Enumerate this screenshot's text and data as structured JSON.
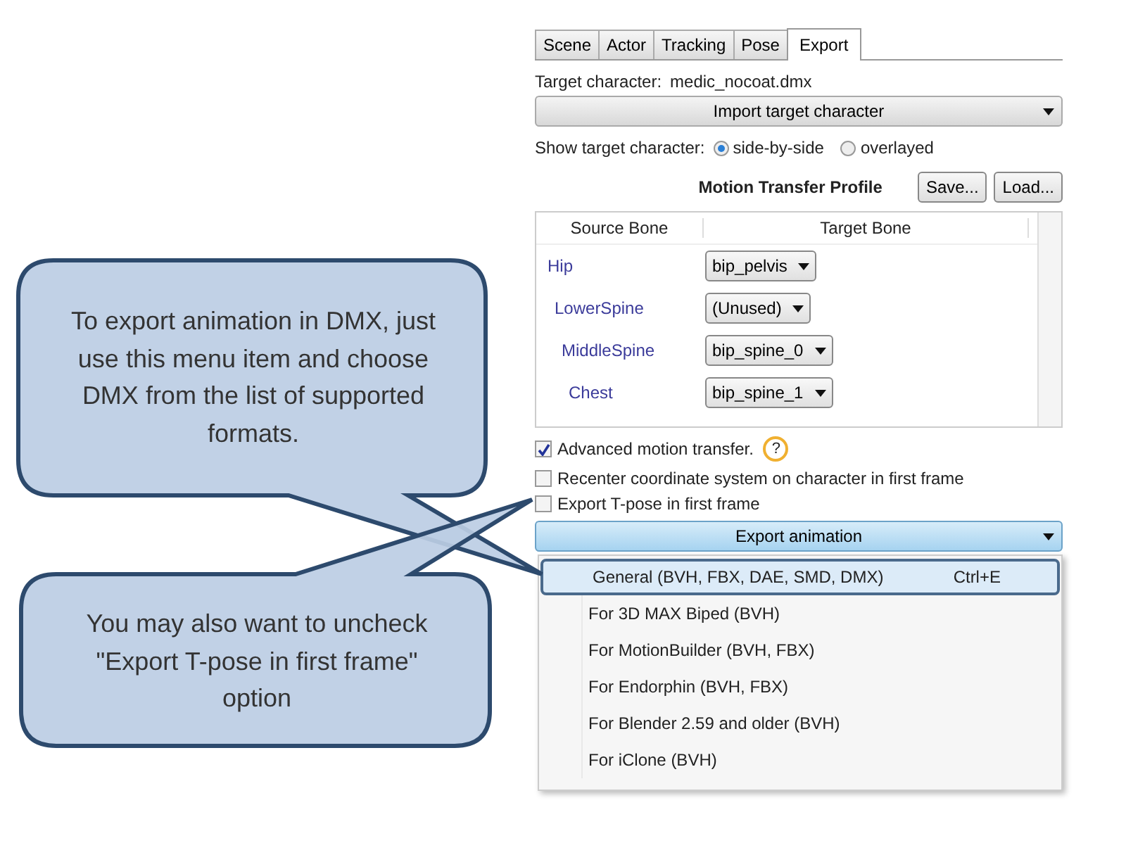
{
  "tabs": [
    {
      "label": "Scene",
      "selected": false
    },
    {
      "label": "Actor",
      "selected": false
    },
    {
      "label": "Tracking",
      "selected": false
    },
    {
      "label": "Pose",
      "selected": false
    },
    {
      "label": "Export",
      "selected": true
    }
  ],
  "target_character": {
    "label": "Target character:",
    "value": "medic_nocoat.dmx"
  },
  "import_button": "Import target character",
  "show_target": {
    "label": "Show target character:",
    "options": [
      {
        "label": "side-by-side",
        "selected": true
      },
      {
        "label": "overlayed",
        "selected": false
      }
    ]
  },
  "profile": {
    "title": "Motion Transfer Profile",
    "buttons": [
      "Save...",
      "Load..."
    ]
  },
  "bone_table": {
    "columns": [
      "Source Bone",
      "Target Bone"
    ],
    "rows": [
      {
        "source": "Hip",
        "target": "bip_pelvis",
        "children": [
          {
            "source": "LowerSpine",
            "target": "(Unused)",
            "children": [
              {
                "source": "MiddleSpine",
                "target": "bip_spine_0",
                "children": [
                  {
                    "source": "Chest",
                    "target": "bip_spine_1"
                  }
                ]
              }
            ]
          }
        ]
      }
    ]
  },
  "options": [
    {
      "label": "Advanced motion transfer.",
      "checked": true,
      "help": "?"
    },
    {
      "label": "Recenter coordinate system on character in first frame",
      "checked": false
    },
    {
      "label": "Export T-pose in first frame",
      "checked": false
    }
  ],
  "export_button": "Export animation",
  "export_menu": [
    {
      "label": "General (BVH, FBX, DAE, SMD, DMX)",
      "shortcut": "Ctrl+E",
      "selected": true
    },
    {
      "label": "For 3D MAX Biped (BVH)",
      "selected": false
    },
    {
      "label": "For MotionBuilder (BVH, FBX)",
      "selected": false
    },
    {
      "label": "For Endorphin (BVH, FBX)",
      "selected": false
    },
    {
      "label": "For Blender 2.59 and older (BVH)",
      "selected": false
    },
    {
      "label": "For iClone (BVH)",
      "selected": false
    }
  ],
  "callouts": [
    {
      "text": "To export animation in DMX, just use this menu item and choose DMX from the list of supported formats."
    },
    {
      "text": "You may also want to uncheck \"Export T-pose in first frame\" option"
    }
  ]
}
